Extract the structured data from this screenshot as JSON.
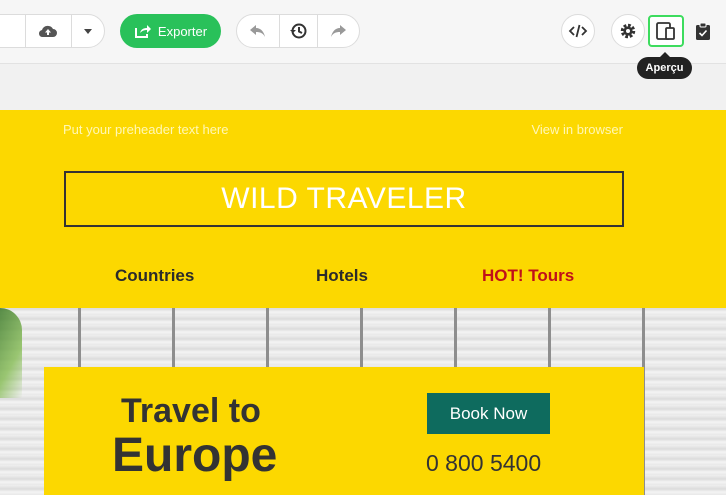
{
  "toolbar": {
    "export_label": "Exporter",
    "tooltip": "Aperçu",
    "icons": {
      "upload": "cloud-upload-icon",
      "dropdown": "caret-down-icon",
      "export": "export-icon",
      "undo": "undo-icon",
      "history": "history-icon",
      "redo": "redo-icon",
      "code": "code-icon",
      "settings": "gear-icon",
      "preview": "devices-icon",
      "clipboard": "clipboard-icon"
    },
    "colors": {
      "export": "#29c15a",
      "preview_highlight": "#3ddc5e"
    }
  },
  "email": {
    "preheader": "Put your preheader text here",
    "view_in_browser": "View in browser",
    "logo": "WILD TRAVELER",
    "nav": [
      "Countries",
      "Hotels",
      "HOT! Tours"
    ],
    "hero": {
      "line1": "Travel to",
      "line2": "Europe",
      "cta": "Book Now",
      "phone": "0 800 5400"
    },
    "colors": {
      "band": "#fcd800",
      "cta": "#0e6b5e",
      "hot": "#c0101a"
    }
  }
}
